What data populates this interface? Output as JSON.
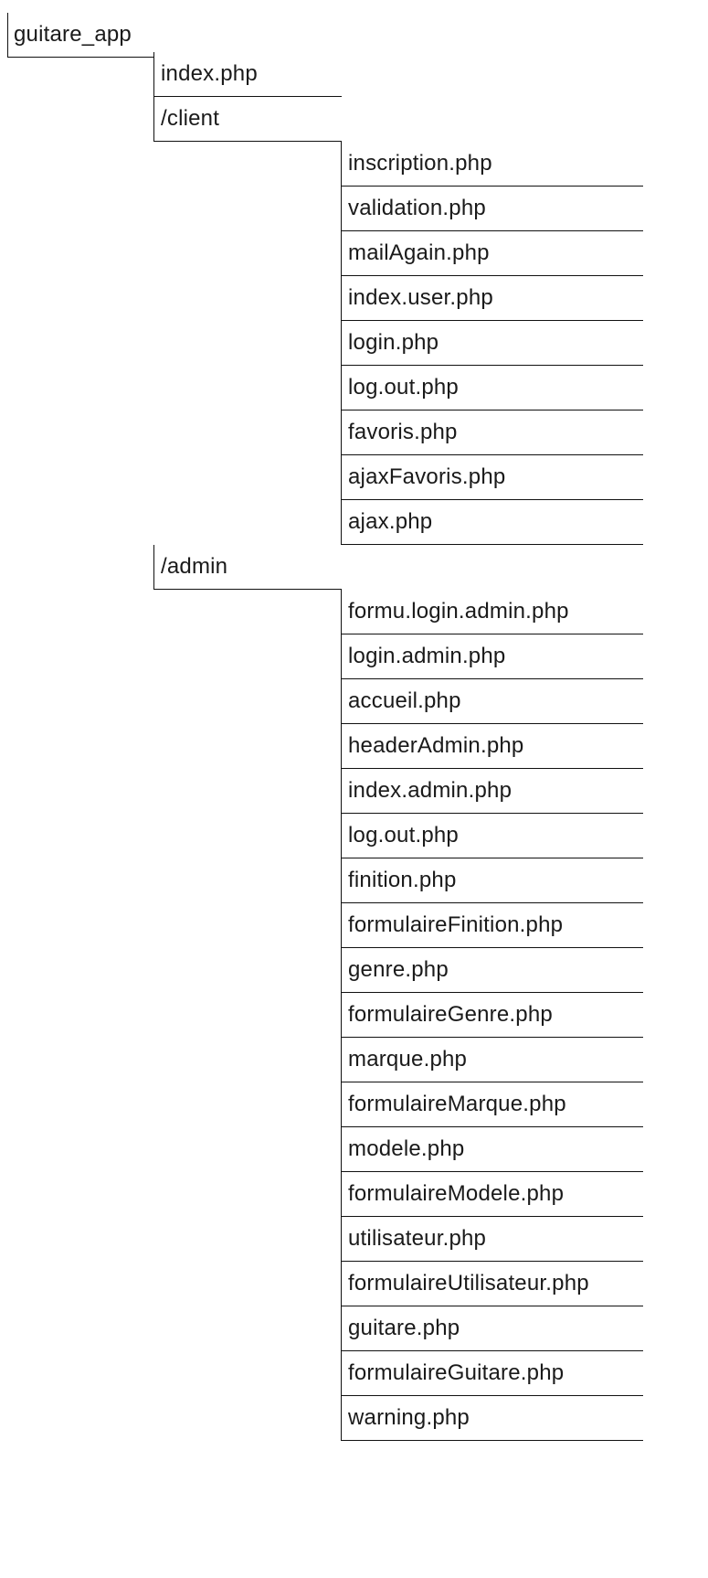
{
  "root": {
    "label": "guitare_app"
  },
  "level1": [
    {
      "label": "index.php"
    },
    {
      "label": "/client"
    },
    {
      "label": "/admin"
    }
  ],
  "client_files": [
    "inscription.php",
    "validation.php",
    "mailAgain.php",
    "index.user.php",
    "login.php",
    "log.out.php",
    "favoris.php",
    "ajaxFavoris.php",
    "ajax.php"
  ],
  "admin_files": [
    "formu.login.admin.php",
    "login.admin.php",
    "accueil.php",
    "headerAdmin.php",
    "index.admin.php",
    "log.out.php",
    "finition.php",
    "formulaireFinition.php",
    "genre.php",
    "formulaireGenre.php",
    "marque.php",
    "formulaireMarque.php",
    "modele.php",
    "formulaireModele.php",
    "utilisateur.php",
    "formulaireUtilisateur.php",
    "guitare.php",
    "formulaireGuitare.php",
    "warning.php"
  ]
}
